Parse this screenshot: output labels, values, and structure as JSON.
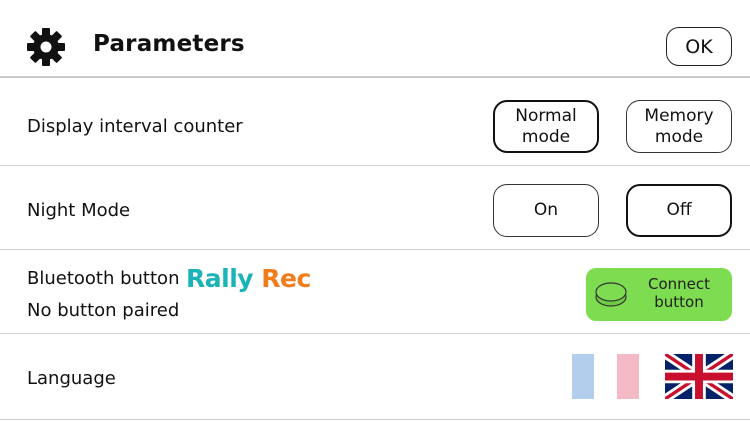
{
  "header": {
    "title": "Parameters",
    "ok_label": "OK",
    "settings_icon": "gear-icon"
  },
  "rows": {
    "display_interval": {
      "label": "Display interval counter",
      "options": [
        "Normal mode",
        "Memory mode"
      ],
      "selected": "Normal mode"
    },
    "night_mode": {
      "label": "Night Mode",
      "options": [
        "On",
        "Off"
      ],
      "selected": "Off"
    },
    "bluetooth": {
      "label": "Bluetooth button",
      "brand_part1": "Rally",
      "brand_part2": "Rec",
      "status": "No button paired",
      "connect_label": "Connect button",
      "connect_color": "#7ddc4f"
    },
    "language": {
      "label": "Language",
      "flags": [
        "french-flag-icon",
        "uk-flag-icon"
      ],
      "selected": "uk-flag-icon"
    }
  },
  "colors": {
    "brand_teal": "#1ab3b8",
    "brand_orange": "#f07c1c"
  }
}
